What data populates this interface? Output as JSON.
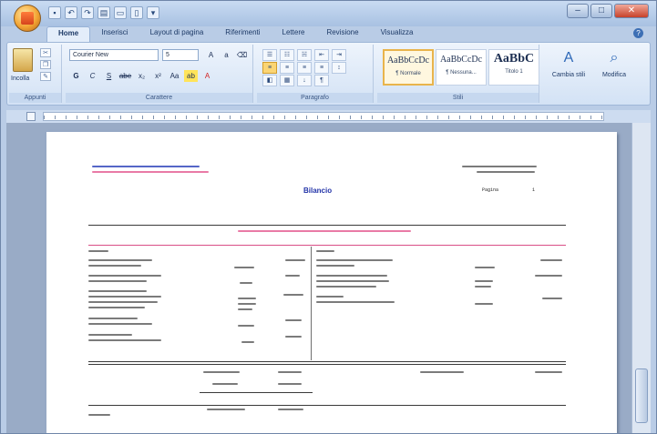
{
  "app": {
    "window_title": "",
    "quick_access": [
      "save",
      "undo",
      "redo",
      "print",
      "open",
      "new"
    ]
  },
  "ribbon": {
    "tabs": [
      "Home",
      "Inserisci",
      "Layout di pagina",
      "Riferimenti",
      "Lettere",
      "Revisione",
      "Visualizza"
    ],
    "active_tab": "Home",
    "clipboard": {
      "paste_label": "Incolla",
      "group_label": "Appunti"
    },
    "font": {
      "name": "Courier New",
      "size": "5",
      "group_label": "Carattere",
      "buttons": [
        "G",
        "C",
        "S",
        "abe",
        "x₂",
        "x²",
        "Aa"
      ]
    },
    "paragraph": {
      "group_label": "Paragrafo"
    },
    "styles": {
      "group_label": "Stili",
      "items": [
        {
          "sample": "AaBbCcDc",
          "name": "¶ Normale"
        },
        {
          "sample": "AaBbCcDc",
          "name": "¶ Nessuna..."
        },
        {
          "sample": "AaBbC",
          "name": "Titolo 1"
        }
      ]
    },
    "editing": {
      "change_styles": "Cambia stili",
      "edit": "Modifica"
    }
  },
  "document": {
    "title": "Bilancio",
    "page_label": "Pagina",
    "page_number": "1"
  }
}
